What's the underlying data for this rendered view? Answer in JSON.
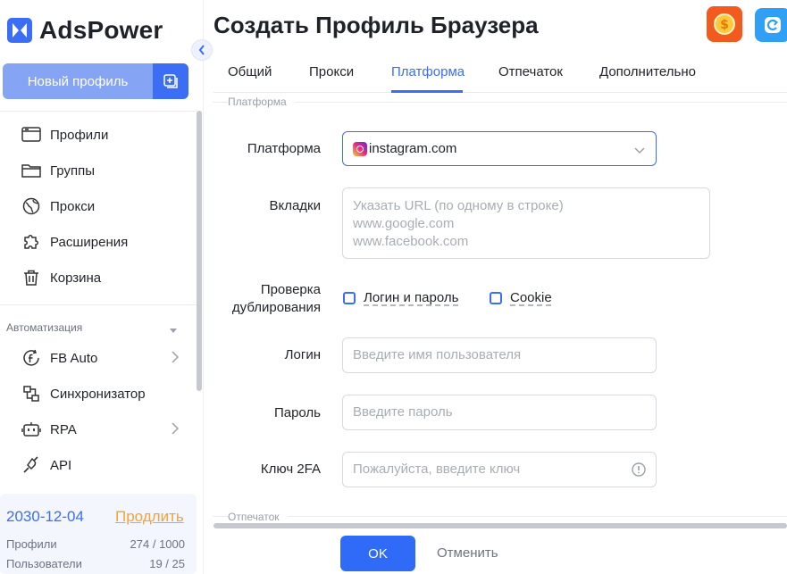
{
  "brand": {
    "name": "AdsPower"
  },
  "sidebar": {
    "new_profile_label": "Новый профиль",
    "items": [
      {
        "label": "Профили",
        "icon": "profiles-icon"
      },
      {
        "label": "Группы",
        "icon": "folder-icon"
      },
      {
        "label": "Прокси",
        "icon": "globe-icon"
      },
      {
        "label": "Расширения",
        "icon": "puzzle-icon"
      },
      {
        "label": "Корзина",
        "icon": "trash-icon"
      }
    ],
    "automation_label": "Автоматизация",
    "automation_items": [
      {
        "label": "FB Auto",
        "icon": "facebook-icon"
      },
      {
        "label": "Синхронизатор",
        "icon": "sync-icon"
      },
      {
        "label": "RPA",
        "icon": "robot-icon"
      },
      {
        "label": "API",
        "icon": "plug-icon"
      }
    ],
    "plan": {
      "expiry_date": "2030-12-04",
      "renew_label": "Продлить",
      "profiles_label": "Профили",
      "profiles_value": "274 / 1000",
      "users_label": "Пользователи",
      "users_value": "19 / 25"
    }
  },
  "header": {
    "title": "Создать Профиль Браузера"
  },
  "tabs": [
    {
      "label": "Общий"
    },
    {
      "label": "Прокси"
    },
    {
      "label": "Платформа"
    },
    {
      "label": "Отпечаток"
    },
    {
      "label": "Дополнительно"
    }
  ],
  "active_tab": "Платформа",
  "form": {
    "section_platform": "Платформа",
    "platform_label": "Платформа",
    "platform_value": "instagram.com",
    "tabs_label": "Вкладки",
    "tabs_placeholder": "Указать URL (по одному в строке)\nwww.google.com\nwww.facebook.com",
    "dup_label_1": "Проверка",
    "dup_label_2": "дублирования",
    "dup_option_1": "Логин и пароль",
    "dup_option_2": "Cookie",
    "login_label": "Логин",
    "login_placeholder": "Введите имя пользователя",
    "password_label": "Пароль",
    "password_placeholder": "Введите пароль",
    "key2fa_label": "Ключ 2FA",
    "key2fa_placeholder": "Пожалуйста, введите ключ",
    "section_fingerprint": "Отпечаток"
  },
  "footer": {
    "ok_label": "OK",
    "cancel_label": "Отменить"
  },
  "colors": {
    "accent": "#3b6ef5",
    "renew": "#f2a33a",
    "button_light": "#86a4f4"
  }
}
